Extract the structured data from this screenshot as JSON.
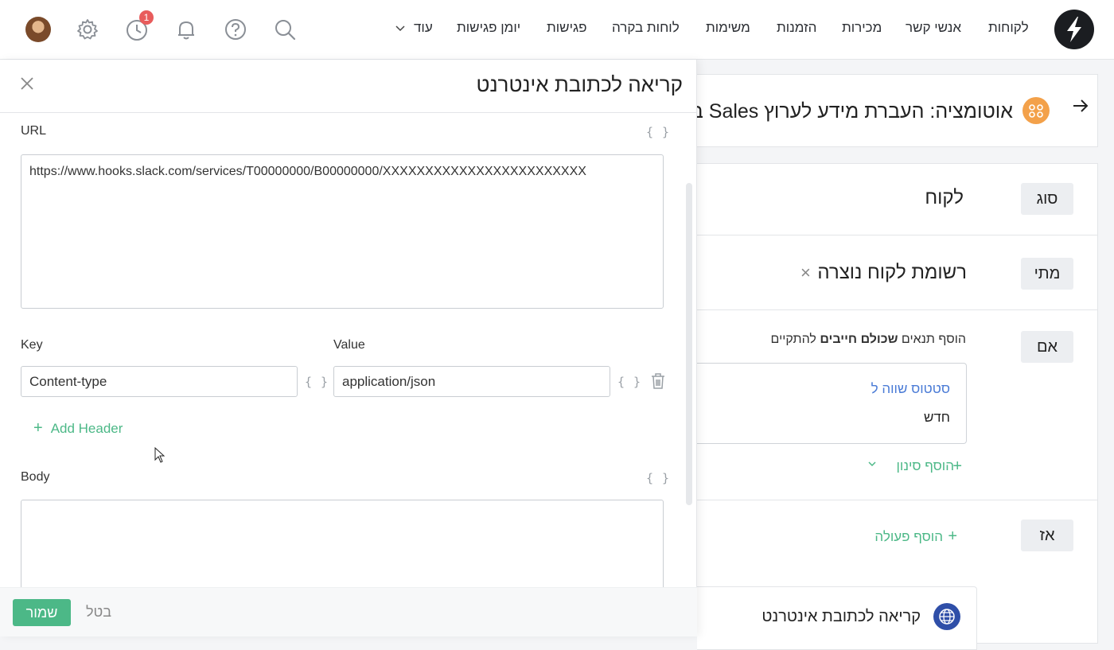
{
  "nav": {
    "items": [
      "לקוחות",
      "אנשי קשר",
      "מכירות",
      "הזמנות",
      "משימות",
      "לוחות בקרה",
      "פגישות",
      "יומן פגישות"
    ],
    "more": "עוד",
    "badge_count": "1"
  },
  "icons": {
    "logo": "bolt-logo-icon",
    "search": "search-icon",
    "help": "help-icon",
    "bell": "bell-icon",
    "clock": "clock-icon",
    "settings": "gear-icon"
  },
  "automation": {
    "title": "אוטומציה: העברת מידע לערוץ Sales ב",
    "rows": {
      "type_label": "סוג",
      "type_value": "לקוח",
      "when_label": "מתי",
      "when_value": "רשומת לקוח נוצרה",
      "if_label": "אם",
      "if_prefix": "הוסף תנאים ",
      "if_bold": "שכולם חייבים",
      "if_suffix": " להתקיים",
      "condition_field": "סטטוס שווה ל",
      "condition_value": "חדש",
      "add_filter": "הוסף סינון",
      "then_label": "אז",
      "add_action": "הוסף פעולה",
      "action_title": "קריאה לכתובת אינטרנט"
    }
  },
  "drawer": {
    "title": "קריאה לכתובת אינטרנט",
    "url_label": "URL",
    "url_value": "https://www.hooks.slack.com/services/T00000000/B00000000/XXXXXXXXXXXXXXXXXXXXXXXX",
    "var_symbol": "{ }",
    "key_label": "Key",
    "value_label": "Value",
    "header_key": "Content-type",
    "header_value": "application/json",
    "add_header": "Add Header",
    "body_label": "Body",
    "body_value": "",
    "save": "שמור",
    "cancel": "בטל"
  },
  "colors": {
    "accent_green": "#4cb887",
    "link_blue": "#4a7bd6",
    "badge_red": "#e85c5c",
    "automation_icon": "#f3a14a",
    "globe_icon": "#2f4fa8"
  }
}
